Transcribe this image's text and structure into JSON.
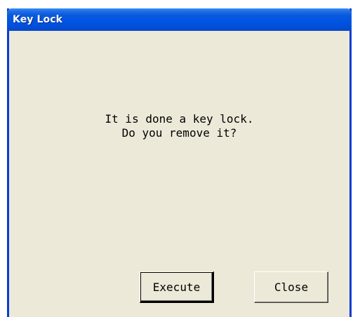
{
  "window": {
    "title": "Key Lock"
  },
  "dialog": {
    "message_line1": "It is done a key lock.",
    "message_line2": "Do you remove it?"
  },
  "buttons": {
    "execute_label": "Execute",
    "close_label": "Close"
  },
  "colors": {
    "titlebar": "#0054e3",
    "frame": "#0a3bd1",
    "client_background": "#ece9d8",
    "title_text": "#ffffff"
  }
}
